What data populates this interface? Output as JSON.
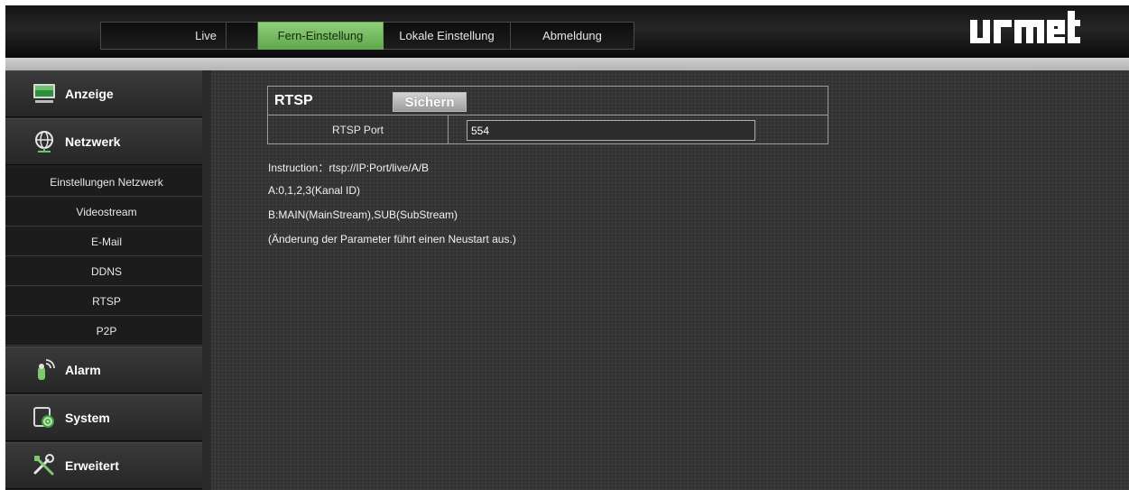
{
  "topnav": {
    "tabs": [
      {
        "label": "Live"
      },
      {
        "label": "Fern-Einstellung"
      },
      {
        "label": "Lokale Einstellung"
      },
      {
        "label": "Abmeldung"
      }
    ],
    "active_tab": "Fern-Einstellung",
    "logo_text": "urmet",
    "accent_color": "#6cbf57"
  },
  "sidebar": {
    "sections": [
      {
        "label": "Anzeige",
        "icon": "monitor-icon"
      },
      {
        "label": "Netzwerk",
        "icon": "network-globe-icon"
      },
      {
        "label": "Alarm",
        "icon": "alarm-icon"
      },
      {
        "label": "System",
        "icon": "system-gear-icon"
      },
      {
        "label": "Erweitert",
        "icon": "tools-icon"
      }
    ],
    "network_items": [
      {
        "label": "Einstellungen Netzwerk"
      },
      {
        "label": "Videostream"
      },
      {
        "label": "E-Mail"
      },
      {
        "label": "DDNS"
      },
      {
        "label": "RTSP"
      },
      {
        "label": "P2P"
      }
    ]
  },
  "rtsp": {
    "title": "RTSP",
    "save_label": "Sichern",
    "port_label": "RTSP Port",
    "port_value": "554"
  },
  "instructions": [
    "Instruction：rtsp://IP:Port/live/A/B",
    "A:0,1,2,3(Kanal ID)",
    "B:MAIN(MainStream),SUB(SubStream)",
    "(Änderung der Parameter führt einen Neustart aus.)"
  ]
}
